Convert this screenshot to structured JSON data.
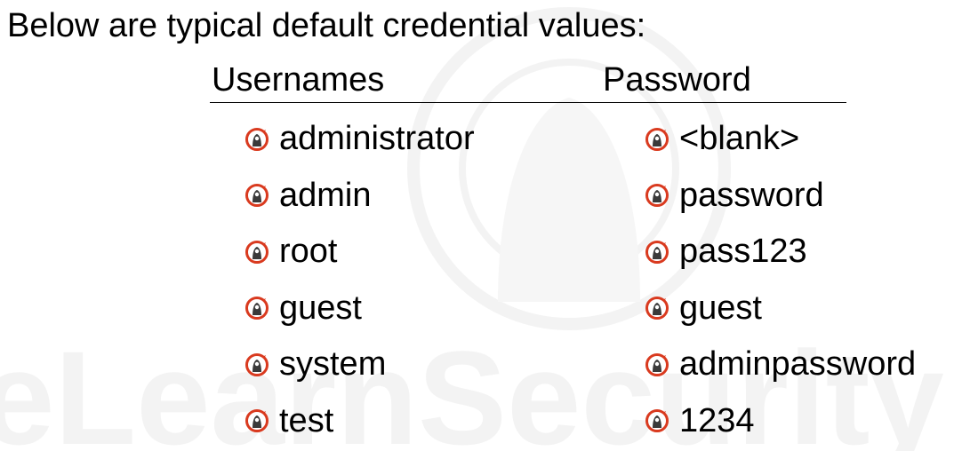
{
  "slide": {
    "title": "Below are typical default credential values:"
  },
  "table": {
    "usernames_header": "Usernames",
    "password_header": "Password",
    "usernames": [
      "administrator",
      "admin",
      "root",
      "guest",
      "system",
      "test"
    ],
    "passwords": [
      "<blank>",
      "password",
      "pass123",
      "guest",
      "adminpassword",
      "1234"
    ]
  },
  "watermark": {
    "text": "eLearnSecurity",
    "icon": "hacker-seal-logo"
  },
  "bullet_icon": "hacker-logo-bullet-icon",
  "colors": {
    "text": "#000000",
    "bullet_red": "#d93a1f",
    "bullet_dark": "#3a3a3a",
    "watermark": "#f2f2f2"
  }
}
